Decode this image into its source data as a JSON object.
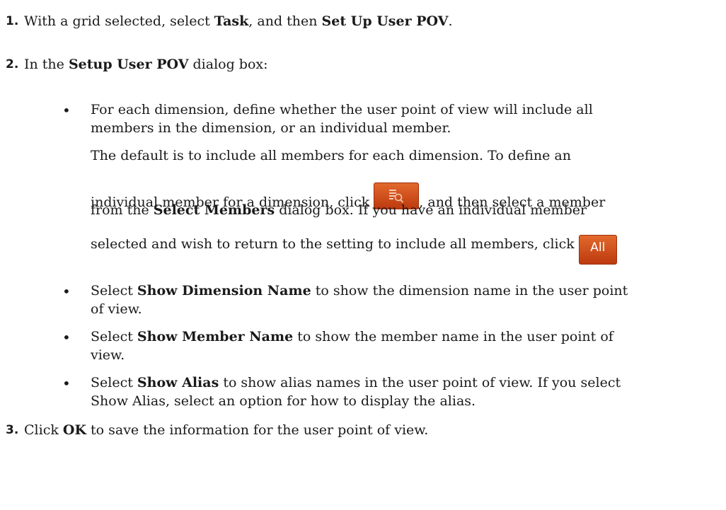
{
  "steps": [
    {
      "num": "1.",
      "t1": "With a grid selected, select ",
      "b1": "Task",
      "t2": ", and then ",
      "b2": "Set Up User POV",
      "t3": "."
    },
    {
      "num": "2.",
      "t1": "In the ",
      "b1": "Setup User POV",
      "t2": " dialog box:"
    },
    {
      "num": "3.",
      "t1": "Click ",
      "b1": "OK",
      "t2": " to save the information for the user point of view."
    }
  ],
  "bullets": [
    {
      "l1": "For each dimension, define whether the user point of view will include all",
      "l2": "members in the dimension, or an individual member.",
      "p1": "The default is to include all members for each dimension. To define an",
      "p2a": "individual member for a dimension, click ",
      "p2b": ", and then select a member",
      "p3a": "from the ",
      "p3b": "Select Members",
      "p3c": " dialog box. If you have an individual member",
      "p4": "selected and wish to return to the setting to include all members, click ",
      "all_label": "All"
    },
    {
      "a": "Select ",
      "b": "Show Dimension Name",
      "c": " to show the dimension name in the user point",
      "d": "of view."
    },
    {
      "a": "Select ",
      "b": "Show Member Name",
      "c": " to show the member name in the user point of",
      "d": "view."
    },
    {
      "a": "Select ",
      "b": "Show Alias",
      "c": " to show alias names in the user point of view. If you select",
      "d": "Show Alias, select an option for how to display the alias."
    }
  ],
  "bullet_char": "•",
  "icons": {
    "member_selector": "member-selector-icon"
  },
  "colors": {
    "button_orange": "#d44f1c"
  }
}
